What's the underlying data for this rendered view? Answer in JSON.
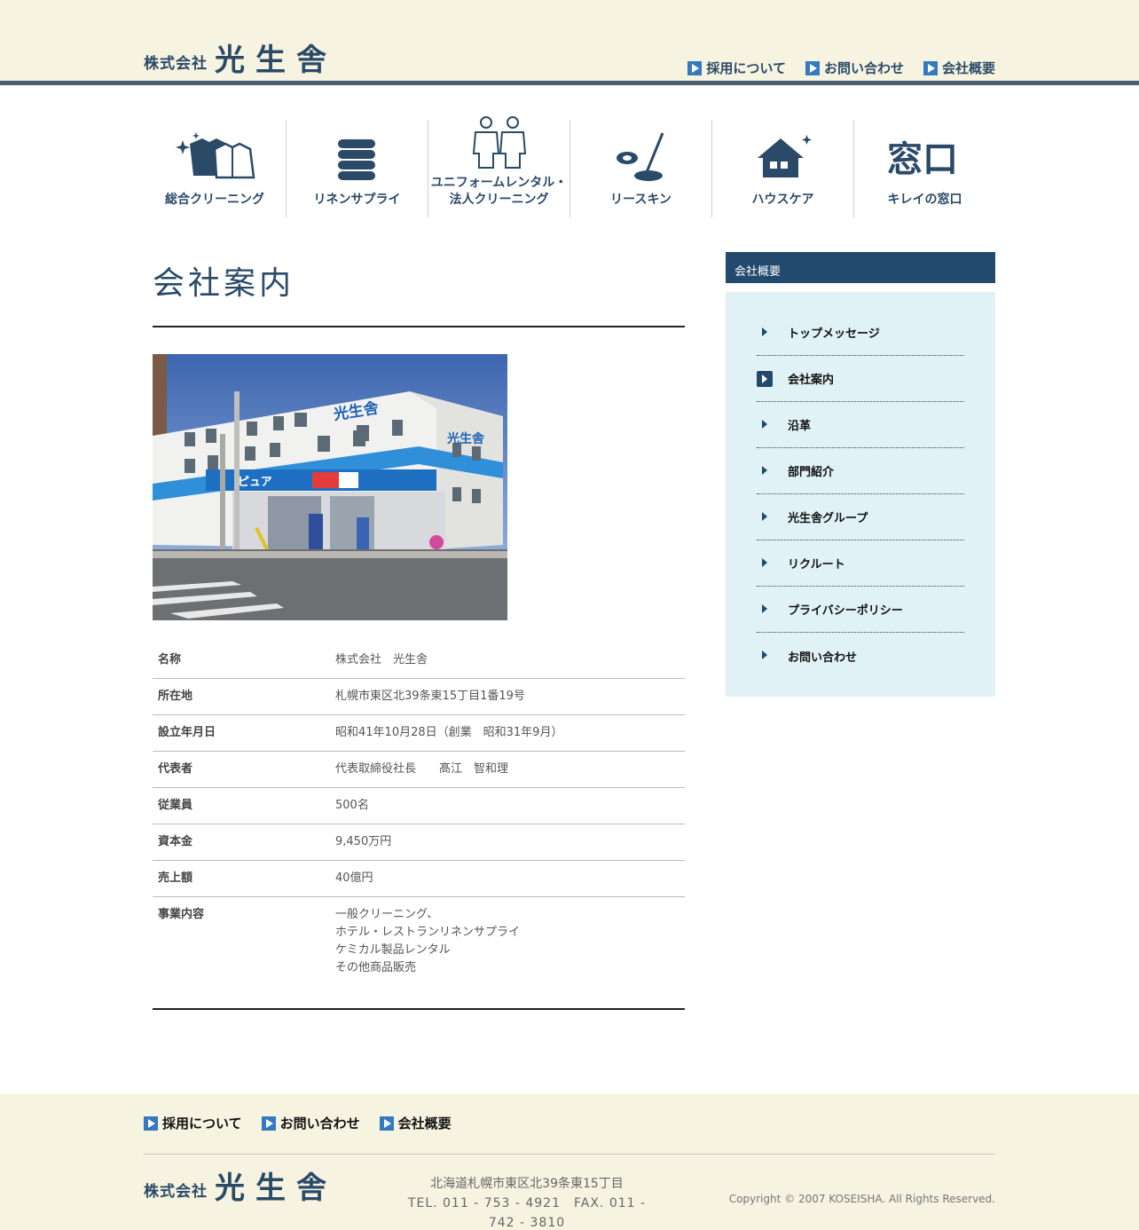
{
  "header": {
    "logo_small": "株式会社",
    "logo_big": "光生舎",
    "links": [
      "採用について",
      "お問い合わせ",
      "会社概要"
    ]
  },
  "gnav": [
    {
      "label": "総合クリーニング",
      "icon": "clothes-icon"
    },
    {
      "label": "リネンサプライ",
      "icon": "linen-stack-icon"
    },
    {
      "label": "ユニフォームレンタル・\n法人クリーニング",
      "icon": "uniform-icon"
    },
    {
      "label": "リースキン",
      "icon": "mop-icon"
    },
    {
      "label": "ハウスケア",
      "icon": "house-icon"
    },
    {
      "label": "キレイの窓口",
      "icon": "window-kanji-icon"
    }
  ],
  "main": {
    "title": "会社案内",
    "photo_signs": {
      "roof": "光生舎",
      "side": "光生舎",
      "store": "ピュア"
    },
    "table": [
      {
        "label": "名称",
        "value": "株式会社　光生舎"
      },
      {
        "label": "所在地",
        "value": "札幌市東区北39条東15丁目1番19号"
      },
      {
        "label": "設立年月日",
        "value": "昭和41年10月28日（創業　昭和31年9月）"
      },
      {
        "label": "代表者",
        "value": "代表取締役社長　　髙江　智和理"
      },
      {
        "label": "従業員",
        "value": "500名"
      },
      {
        "label": "資本金",
        "value": "9,450万円"
      },
      {
        "label": "売上額",
        "value": "40億円"
      },
      {
        "label": "事業内容",
        "value": "一般クリーニング、\nホテル・レストランリネンサプライ\nケミカル製品レンタル\nその他商品販売"
      }
    ]
  },
  "side": {
    "heading": "会社概要",
    "items": [
      {
        "label": "トップメッセージ",
        "active": false
      },
      {
        "label": "会社案内",
        "active": true
      },
      {
        "label": "沿革",
        "active": false
      },
      {
        "label": "部門紹介",
        "active": false
      },
      {
        "label": "光生舎グループ",
        "active": false
      },
      {
        "label": "リクルート",
        "active": false
      },
      {
        "label": "プライバシーポリシー",
        "active": false
      },
      {
        "label": "お問い合わせ",
        "active": false
      }
    ]
  },
  "footer": {
    "links": [
      "採用について",
      "お問い合わせ",
      "会社概要"
    ],
    "logo_small": "株式会社",
    "logo_big": "光生舎",
    "address": "北海道札幌市東区北39条東15丁目",
    "tel": "TEL. 011 - 753 - 4921　FAX. 011 - 742 - 3810",
    "copyright": "Copyright © 2007 KOSEISHA. All Rights Reserved."
  },
  "colors": {
    "navy": "#2a4a68",
    "header_bg": "#f6f3e1",
    "side_head": "#224a6c",
    "side_bg": "#e1f2f6",
    "link_blue": "#3579c0"
  }
}
